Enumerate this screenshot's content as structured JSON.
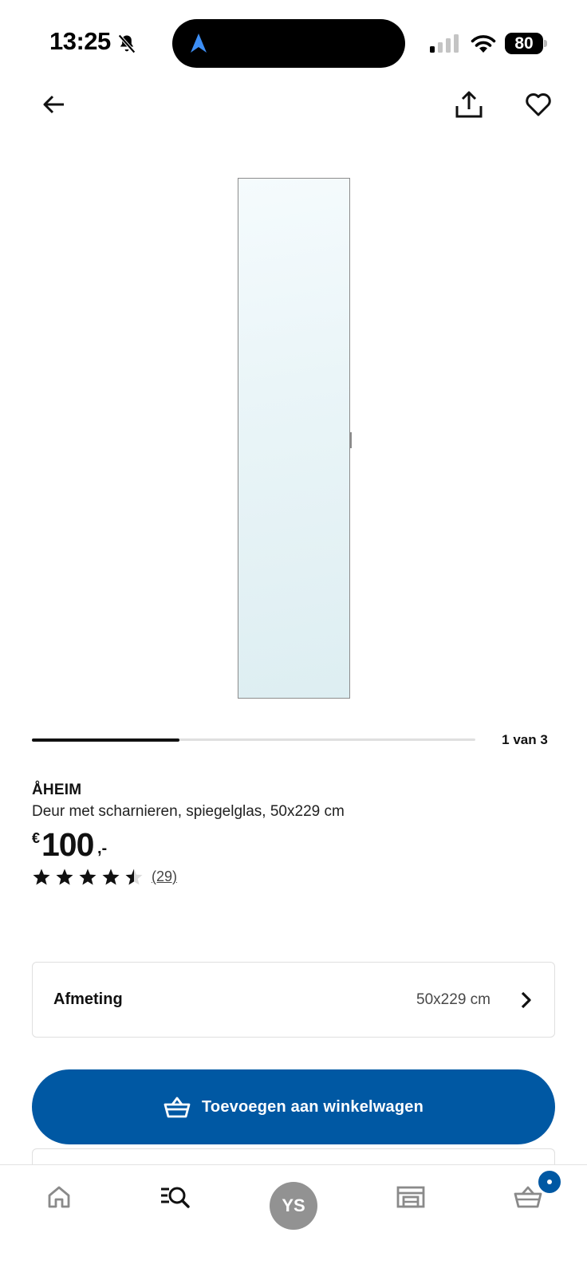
{
  "status_bar": {
    "time": "13:25",
    "battery": "80"
  },
  "header": {
    "back_icon": "arrow-left-icon",
    "share_icon": "share-icon",
    "favorite_icon": "heart-icon"
  },
  "gallery": {
    "counter": "1 van 3",
    "progress": 0.333
  },
  "product": {
    "name": "ÅHEIM",
    "description": "Deur met scharnieren, spiegelglas, 50x229 cm",
    "price_currency": "€",
    "price_amount": "100",
    "price_decimals": ",-",
    "rating": 4.5,
    "rating_max": 5,
    "review_count": "(29)"
  },
  "size_selector": {
    "label": "Afmeting",
    "value": "50x229 cm"
  },
  "add_to_cart": {
    "label": "Toevoegen aan winkelwagen"
  },
  "bottom_nav": {
    "profile_initials": "YS",
    "items": [
      "home-icon",
      "search-icon",
      "profile-avatar",
      "store-icon",
      "cart-icon"
    ]
  },
  "colors": {
    "primary": "#0058a3",
    "text": "#111111",
    "border": "#dfdfdf",
    "avatar": "#929292"
  }
}
